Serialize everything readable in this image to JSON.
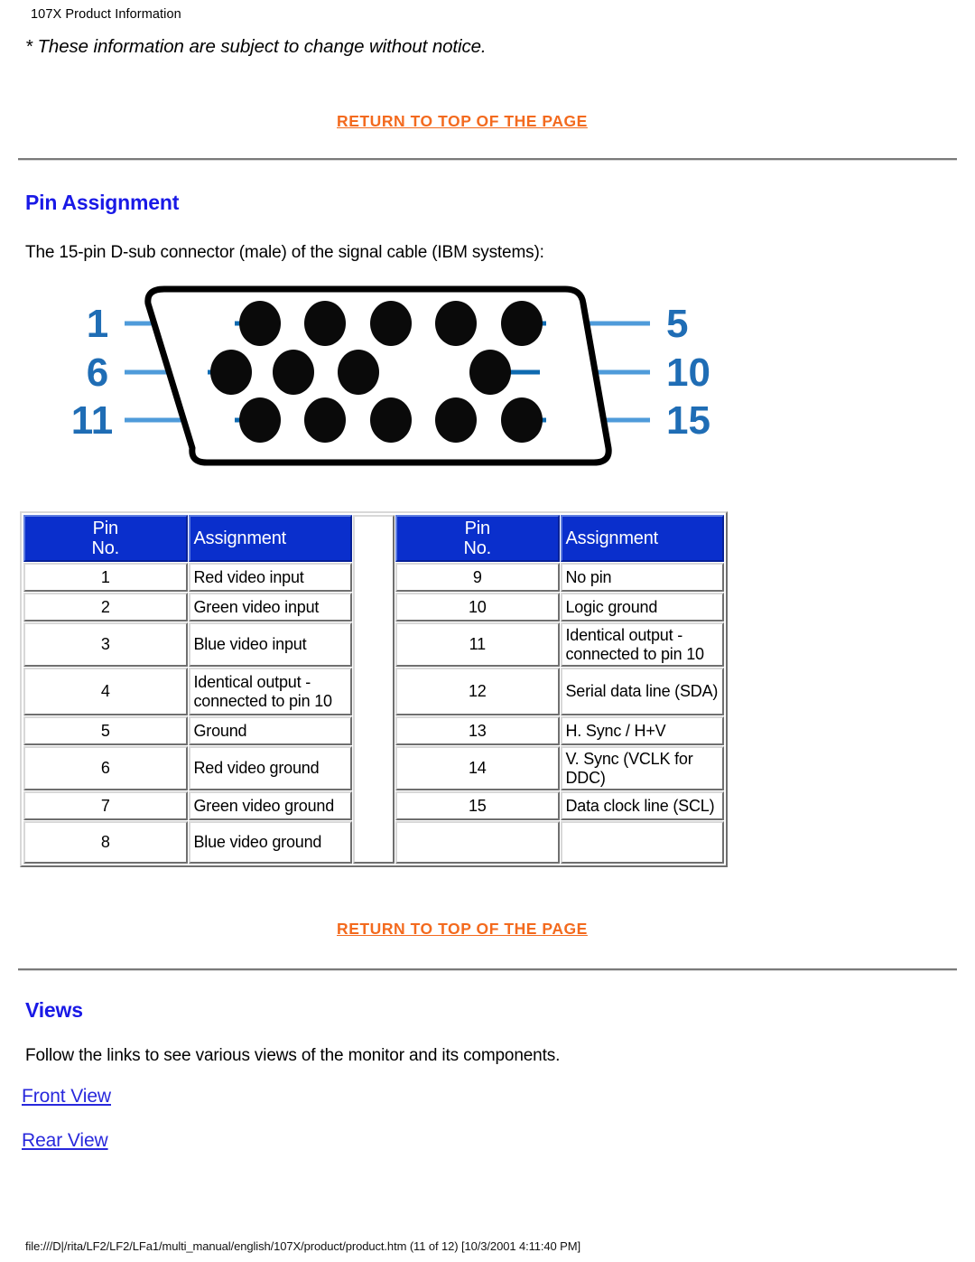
{
  "page": {
    "label": "107X Product Information",
    "notice": "* These information are subject to change without notice.",
    "footer_path": "file:///D|/rita/LF2/LF2/LFa1/multi_manual/english/107X/product/product.htm (11 of 12) [10/3/2001 4:11:40 PM]"
  },
  "links": {
    "return_top_1": "RETURN TO TOP OF THE PAGE",
    "return_top_2": "RETURN TO TOP OF THE PAGE",
    "front_view": "Front View",
    "rear_view": "Rear View"
  },
  "sections": {
    "pin_assignment": {
      "heading": "Pin Assignment",
      "intro": "The 15-pin D-sub connector (male) of the signal cable (IBM systems):"
    },
    "views": {
      "heading": "Views",
      "intro": "Follow the links to see various views of the monitor and its components."
    }
  },
  "connector_diagram": {
    "left_labels": [
      "1",
      "6",
      "11"
    ],
    "right_labels": [
      "5",
      "10",
      "15"
    ],
    "rows": [
      {
        "pins": 5,
        "missing": []
      },
      {
        "pins": 5,
        "missing": [
          4
        ]
      },
      {
        "pins": 5,
        "missing": []
      }
    ],
    "outline_color": "#000000",
    "pin_color": "#0A0A0A",
    "label_color": "#1F6DB5",
    "leader_color": "#4F9BDA"
  },
  "table": {
    "header": {
      "pin_no_line1": "Pin",
      "pin_no_line2": "No.",
      "assignment": "Assignment"
    },
    "header_bg": "#0A2FCC",
    "left_rows": [
      {
        "no": "1",
        "assignment": "Red video input",
        "size": "normal"
      },
      {
        "no": "2",
        "assignment": "Green video input",
        "size": "normal"
      },
      {
        "no": "3",
        "assignment": "Blue video input",
        "size": "tall"
      },
      {
        "no": "4",
        "assignment": "Identical output - connected to pin 10",
        "size": "wrap"
      },
      {
        "no": "5",
        "assignment": "Ground",
        "size": "normal"
      },
      {
        "no": "6",
        "assignment": "Red video ground",
        "size": "normal"
      },
      {
        "no": "7",
        "assignment": "Green video ground",
        "size": "normal"
      },
      {
        "no": "8",
        "assignment": "Blue video ground",
        "size": "tall"
      }
    ],
    "right_rows": [
      {
        "no": "9",
        "assignment": "No pin",
        "size": "normal"
      },
      {
        "no": "10",
        "assignment": "Logic ground",
        "size": "normal"
      },
      {
        "no": "11",
        "assignment": "Identical output - connected to pin 10",
        "size": "wrap"
      },
      {
        "no": "12",
        "assignment": "Serial data line (SDA)",
        "size": "tall"
      },
      {
        "no": "13",
        "assignment": "H. Sync / H+V",
        "size": "normal"
      },
      {
        "no": "14",
        "assignment": "V. Sync (VCLK for DDC)",
        "size": "normal"
      },
      {
        "no": "15",
        "assignment": "Data clock line (SCL)",
        "size": "normal"
      },
      {
        "no": "",
        "assignment": "",
        "size": "tall"
      }
    ]
  }
}
